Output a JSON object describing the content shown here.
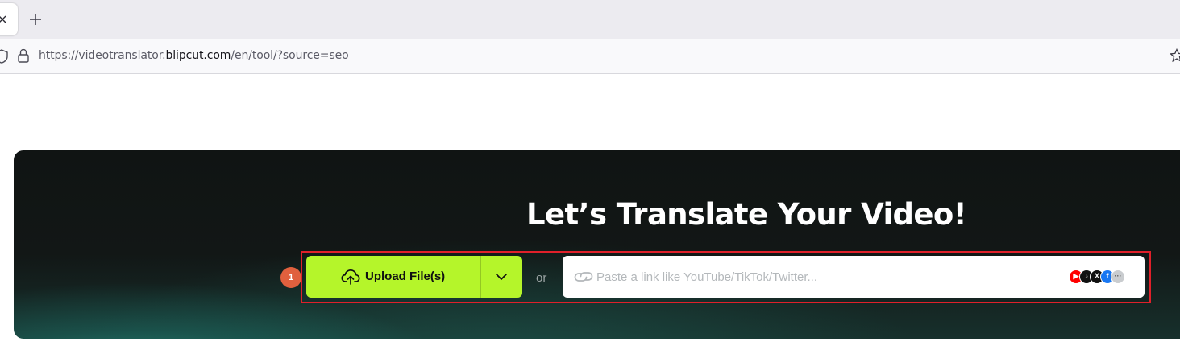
{
  "browser": {
    "url_prefix": "https://videotranslator.",
    "url_host": "blipcut.com",
    "url_suffix": "/en/tool/?source=seo",
    "close_glyph": "×",
    "newtab_glyph": "+"
  },
  "hero": {
    "title": "Let’s Translate Your Video!",
    "step_badge": "1",
    "upload_label": "Upload File(s)",
    "or_label": "or",
    "link_placeholder": "Paste a link like YouTube/TikTok/Twitter...",
    "platform_icons": [
      "youtube-icon",
      "tiktok-icon",
      "x-icon",
      "facebook-icon",
      "more-icon"
    ]
  },
  "colors": {
    "upload_button": "#b5f52a",
    "highlight_box": "#e0202a",
    "step_badge": "#e0603e",
    "youtube": "#ff0000",
    "tiktok": "#111111",
    "x": "#111111",
    "facebook": "#1877f2",
    "more": "#c9cccf"
  }
}
